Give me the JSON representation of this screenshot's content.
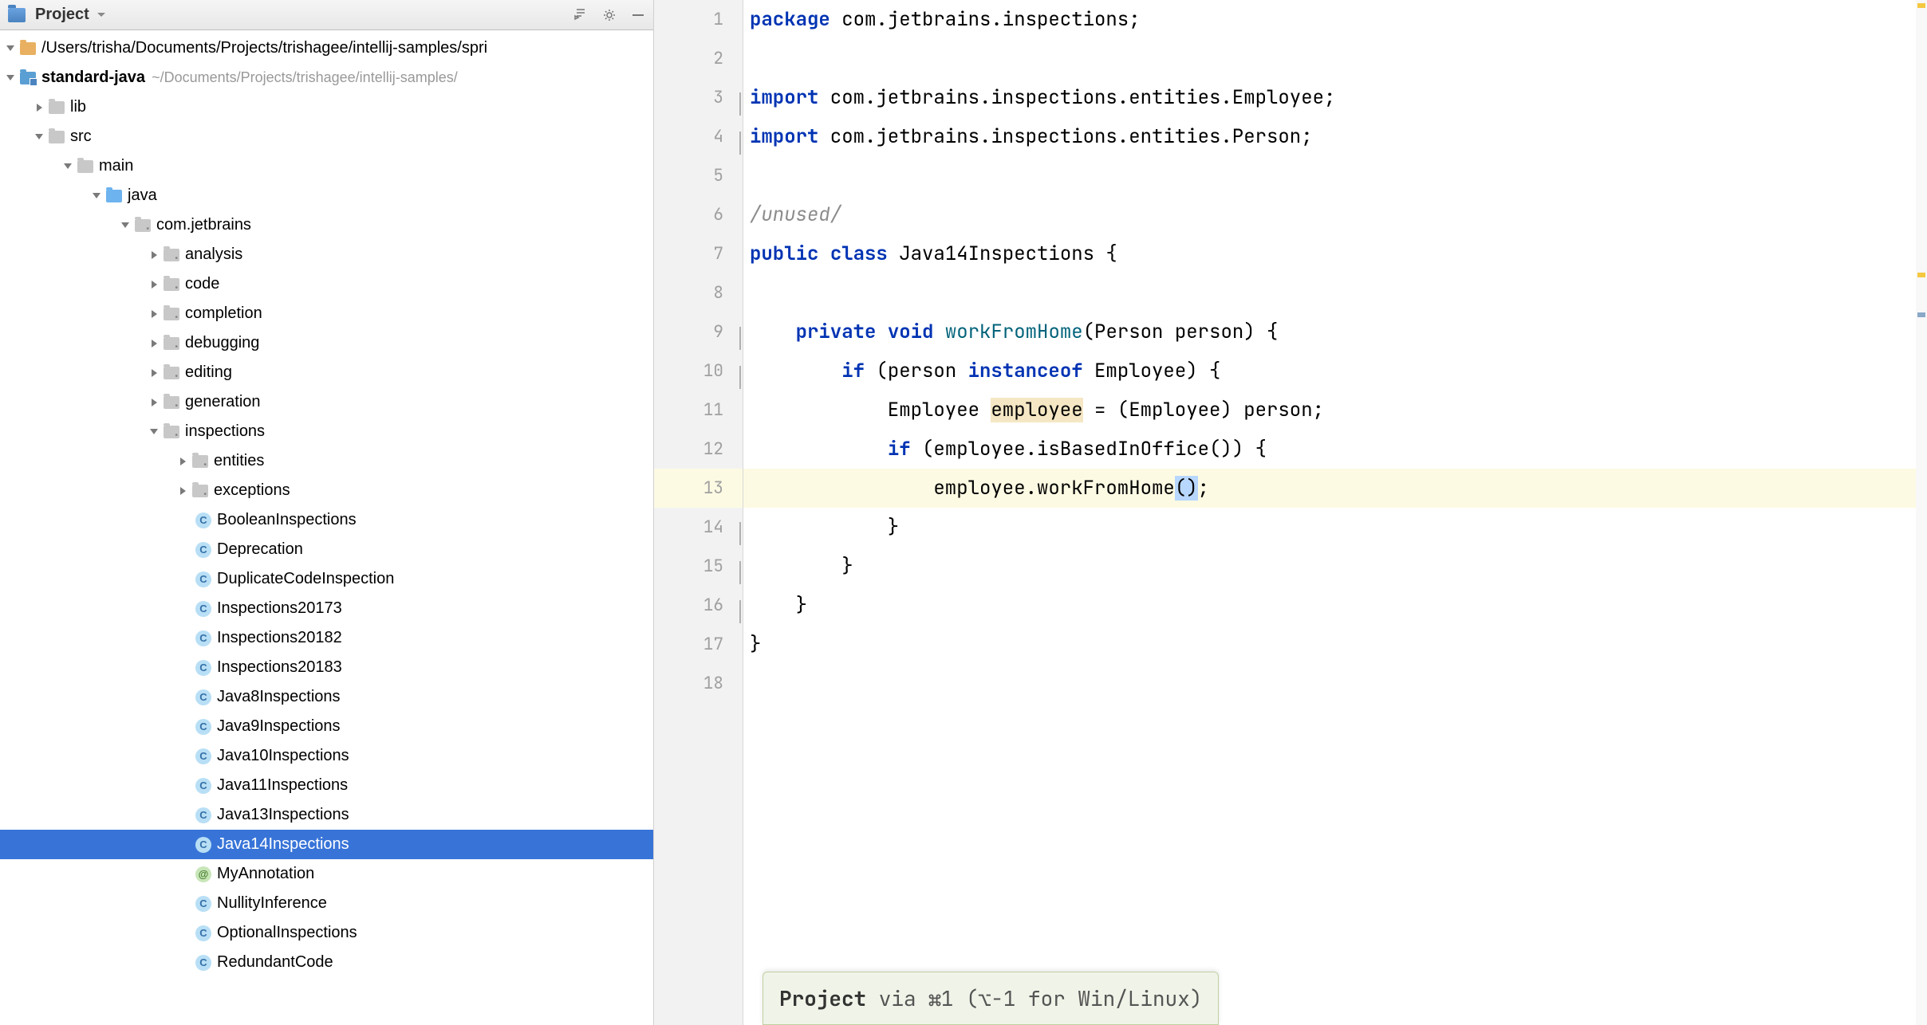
{
  "project": {
    "title": "Project",
    "root_path": "/Users/trisha/Documents/Projects/trishagee/intellij-samples/spri",
    "module_name": "standard-java",
    "module_path": "~/Documents/Projects/trishagee/intellij-samples/"
  },
  "tree": {
    "lib": "lib",
    "src": "src",
    "main": "main",
    "java": "java",
    "pkg": "com.jetbrains",
    "folders": {
      "analysis": "analysis",
      "code": "code",
      "completion": "completion",
      "debugging": "debugging",
      "editing": "editing",
      "generation": "generation",
      "inspections": "inspections",
      "entities": "entities",
      "exceptions": "exceptions"
    },
    "classes": {
      "BooleanInspections": "BooleanInspections",
      "Deprecation": "Deprecation",
      "DuplicateCodeInspection": "DuplicateCodeInspection",
      "Inspections20173": "Inspections20173",
      "Inspections20182": "Inspections20182",
      "Inspections20183": "Inspections20183",
      "Java8Inspections": "Java8Inspections",
      "Java9Inspections": "Java9Inspections",
      "Java10Inspections": "Java10Inspections",
      "Java11Inspections": "Java11Inspections",
      "Java13Inspections": "Java13Inspections",
      "Java14Inspections": "Java14Inspections",
      "MyAnnotation": "MyAnnotation",
      "NullityInference": "NullityInference",
      "OptionalInspections": "OptionalInspections",
      "RedundantCode": "RedundantCode"
    }
  },
  "gutter": [
    "1",
    "2",
    "3",
    "4",
    "5",
    "6",
    "7",
    "8",
    "9",
    "10",
    "11",
    "12",
    "13",
    "14",
    "15",
    "16",
    "17",
    "18"
  ],
  "code": {
    "l1": {
      "kw": "package",
      "rest": " com.jetbrains.inspections;"
    },
    "l3": {
      "kw": "import",
      "rest": " com.jetbrains.inspections.entities.Employee;"
    },
    "l4": {
      "kw": "import",
      "rest": " com.jetbrains.inspections.entities.Person;"
    },
    "l6": "/unused/",
    "l7": {
      "kw1": "public",
      "kw2": "class",
      "name": "Java14Inspections",
      "end": " {"
    },
    "l9": {
      "kw1": "private",
      "kw2": "void",
      "method": "workFromHome",
      "rest": "(Person person) {"
    },
    "l10": {
      "kw1": "if",
      "rest1": " (person ",
      "kw2": "instanceof",
      "rest2": " Employee) {"
    },
    "l11": {
      "pre": "            Employee ",
      "warn": "employee",
      "post": " = (Employee) person;"
    },
    "l12": {
      "kw": "if",
      "rest": " (employee.isBasedInOffice()) {"
    },
    "l13": {
      "pre": "                employee.workFromHome",
      "hl": "()",
      "post": ";"
    },
    "l14": "            }",
    "l15": "        }",
    "l16": "    }",
    "l17": "}"
  },
  "hint": {
    "bold": "Project",
    "rest": " via ⌘1 (⌥-1 for Win/Linux)"
  }
}
